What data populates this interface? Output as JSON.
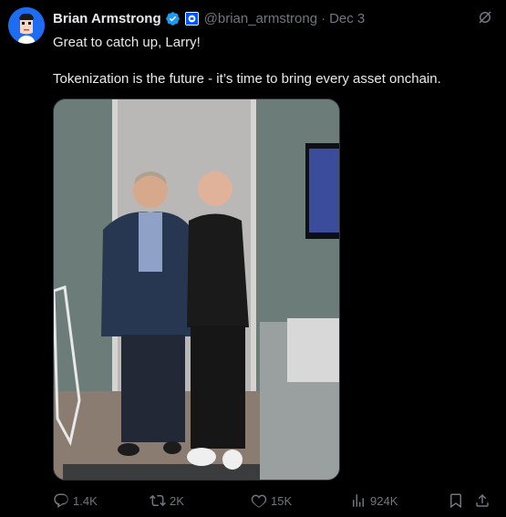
{
  "author": {
    "name": "Brian Armstrong",
    "handle": "@brian_armstrong",
    "date": "Dec 3"
  },
  "post": {
    "line1": "Great to catch up, Larry!",
    "line2": "Tokenization is the future - it’s time to bring every asset onchain."
  },
  "metrics": {
    "replies": "1.4K",
    "reposts": "2K",
    "likes": "15K",
    "views": "924K"
  },
  "colors": {
    "background": "#000000",
    "text": "#e7e9ea",
    "muted": "#71767b",
    "verified": "#1d9bf0",
    "avatar_bg": "#1d6cf2"
  },
  "icons": [
    "verified-badge-icon",
    "affiliate-badge-icon",
    "grok-icon",
    "reply-icon",
    "repost-icon",
    "like-icon",
    "views-icon",
    "bookmark-icon",
    "share-icon"
  ]
}
